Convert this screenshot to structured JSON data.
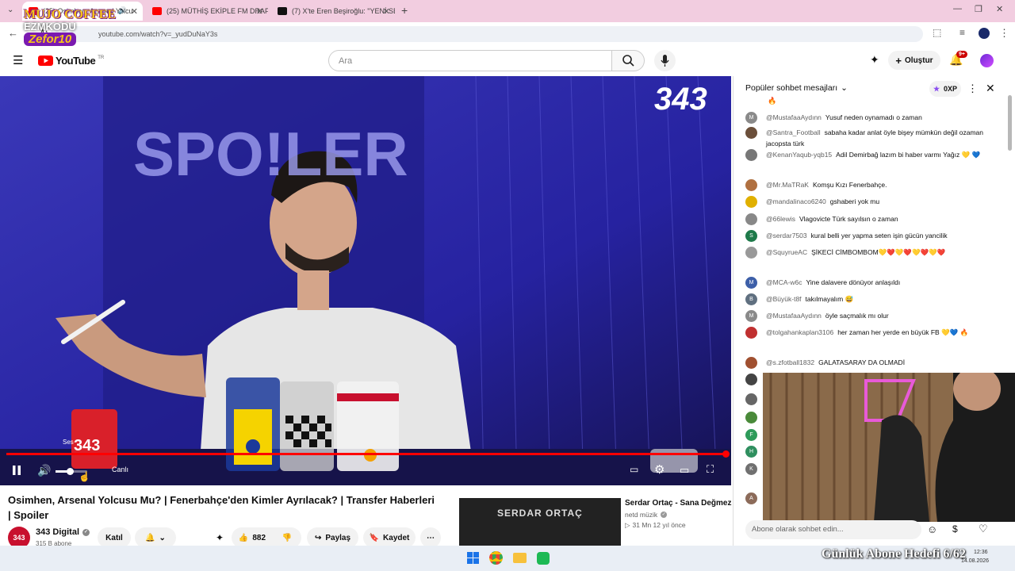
{
  "browser": {
    "tabs": [
      {
        "title": "(25) Osimhen, Arsenal Yolcu"
      },
      {
        "title": "(25) MÜTHİŞ EKİPLE FM DRAFT"
      },
      {
        "title": "(7) X'te Eren Beşiroğlu: \"YENİ SE"
      }
    ],
    "url": "youtube.com/watch?v=_yudDuNaY3s"
  },
  "overlay_logo": {
    "line1": "MUJO COFFEE",
    "line2": "EZMKODU",
    "line3": "Zefor10"
  },
  "youtube": {
    "logo_text": "YouTube",
    "logo_region": "TR",
    "search_placeholder": "Ara",
    "create_label": "Oluştur",
    "notif_badge": "9+"
  },
  "video": {
    "brand_tag": "343",
    "sign_text": "SPO!LER",
    "mug_text": "343",
    "volume_tooltip": "Ses",
    "live_label": "Canlı",
    "progress": 1.0
  },
  "video_info": {
    "title": "Osimhen, Arsenal Yolcusu Mu? | Fenerbahçe'den Kimler Ayrılacak? | Transfer Haberleri | Spoiler",
    "channel": "343 Digital",
    "channel_logo": "343",
    "subscribers": "315 B abone",
    "join_label": "Katıl",
    "likes": "882",
    "share_label": "Paylaş",
    "save_label": "Kaydet"
  },
  "suggested": {
    "title": "Serdar Ortaç - Sana Değmez",
    "channel": "netd müzik",
    "meta": "31 Mn   12 yıl önce",
    "thumb_text": "SERDAR ORTAÇ"
  },
  "chat": {
    "header": "Popüler sohbet mesajları",
    "xp": "0XP",
    "input_placeholder": "Abone olarak sohbet edin...",
    "messages": [
      {
        "user": "@MustafaaAydınn",
        "text": "Yusuf neden oynamadı o zaman",
        "avatar": "M",
        "color": "#8a8a8a"
      },
      {
        "user": "@Santra_Football",
        "text": "sabaha kadar anlat öyle bişey mümkün değil ozaman jacopsta türk",
        "avatar": "",
        "color": "#6b4f3a"
      },
      {
        "user": "@KenanYaqub-yqb15",
        "text": "Adil Demirbağ lazım bi haber varmı Yağız 💛 💙",
        "avatar": "",
        "color": "#777777"
      },
      {
        "user": "@Mr.MaTRaK",
        "text": "Komşu Kızı Fenerbahçe.",
        "avatar": "",
        "color": "#b07040"
      },
      {
        "user": "@mandalinaco6240",
        "text": "gshaberi yok mu",
        "avatar": "",
        "color": "#e0b000"
      },
      {
        "user": "@66lewis",
        "text": "Vlagovicte Türk sayılsın o zaman",
        "avatar": "",
        "color": "#888888"
      },
      {
        "user": "@serdar7503",
        "text": "kural belli yer yapma seten işin gücün yancilik",
        "avatar": "S",
        "color": "#1e7a4a"
      },
      {
        "user": "@SquyrueAC",
        "text": "ŞİKECİ CİMBOMBOM💛❤️💛❤️💛❤️💛❤️",
        "avatar": "",
        "color": "#999999"
      },
      {
        "user": "@MCA-w6c",
        "text": "Yine dalavere dönüyor anlaşıldı",
        "avatar": "M",
        "color": "#3d5fa8"
      },
      {
        "user": "@Büyük-t8f",
        "text": "takılmayalım 😅",
        "avatar": "B",
        "color": "#607080"
      },
      {
        "user": "@MustafaaAydınn",
        "text": "öyle saçmalık mı olur",
        "avatar": "M",
        "color": "#8a8a8a"
      },
      {
        "user": "@tolgahankaplan3106",
        "text": "her zaman her yerde en büyük FB 💛💙 🔥",
        "avatar": "",
        "color": "#c03030"
      },
      {
        "user": "@s.zfotball1832",
        "text": "GALATASARAY DA OLMADİ",
        "avatar": "",
        "color": "#a05030"
      }
    ],
    "extra_avatars": [
      {
        "avatar": "",
        "color": "#444444"
      },
      {
        "avatar": "",
        "color": "#666666"
      },
      {
        "avatar": "",
        "color": "#4a8a3a"
      },
      {
        "avatar": "F",
        "color": "#2e9b5a"
      },
      {
        "avatar": "H",
        "color": "#2f8f5f"
      },
      {
        "avatar": "K",
        "color": "#707070"
      },
      {
        "avatar": "A",
        "color": "#8c6b5a"
      }
    ]
  },
  "stream_overlay": {
    "goal_text": "Günlük Abone Hedefi 6/",
    "goal_extra": "62",
    "time": "12:36",
    "date": "14.08.2026"
  }
}
